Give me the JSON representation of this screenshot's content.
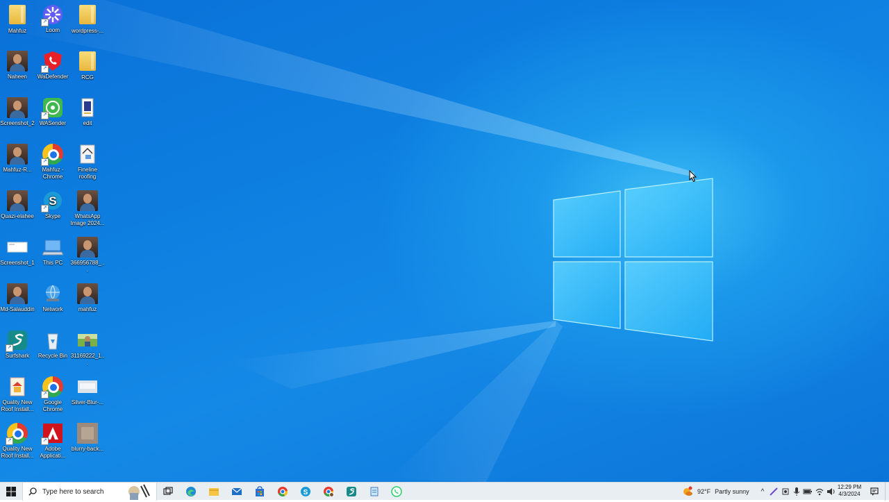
{
  "desktop": {
    "icons": [
      {
        "id": "mahfuz-folder",
        "label": "Mahfuz",
        "kind": "folder-user"
      },
      {
        "id": "loom",
        "label": "Loom",
        "kind": "loom"
      },
      {
        "id": "wordpress-folder",
        "label": "wordpress-...",
        "kind": "zip-folder"
      },
      {
        "id": "naheen",
        "label": "Naheen",
        "kind": "photo"
      },
      {
        "id": "wadefender",
        "label": "WaDefender",
        "kind": "wadefender"
      },
      {
        "id": "rcg-folder",
        "label": "RCG",
        "kind": "zip-folder"
      },
      {
        "id": "screenshot-2",
        "label": "Screenshot_2",
        "kind": "photo"
      },
      {
        "id": "wasender",
        "label": "WASender",
        "kind": "wasender"
      },
      {
        "id": "edit",
        "label": "edit",
        "kind": "document"
      },
      {
        "id": "mahfuz-r",
        "label": "Mahfuz-R...",
        "kind": "photo"
      },
      {
        "id": "mahfuz-chrome",
        "label": "Mahfuz - Chrome",
        "kind": "chrome"
      },
      {
        "id": "fineline-roofing",
        "label": "Fineline roofing",
        "kind": "fineline"
      },
      {
        "id": "quazi-elahee",
        "label": "Quazi-elahee",
        "kind": "photo"
      },
      {
        "id": "skype",
        "label": "Skype",
        "kind": "skype"
      },
      {
        "id": "whatsapp-image",
        "label": "WhatsApp Image 2024...",
        "kind": "photo"
      },
      {
        "id": "screenshot-1",
        "label": "Screenshot_1",
        "kind": "screenshot"
      },
      {
        "id": "this-pc",
        "label": "This PC",
        "kind": "this-pc"
      },
      {
        "id": "file-366956788",
        "label": "366956788_...",
        "kind": "photo"
      },
      {
        "id": "md-salauddin",
        "label": "Md-Salauddin",
        "kind": "photo"
      },
      {
        "id": "network",
        "label": "Network",
        "kind": "network"
      },
      {
        "id": "mahfuz-photo",
        "label": "mahfuz",
        "kind": "photo"
      },
      {
        "id": "surfshark",
        "label": "Surfshark",
        "kind": "surfshark"
      },
      {
        "id": "recycle-bin",
        "label": "Recycle Bin",
        "kind": "recycle-bin"
      },
      {
        "id": "file-31169222",
        "label": "31169222_1...",
        "kind": "landscape"
      },
      {
        "id": "quality-new-roof-1",
        "label": "Quality New Roof Install...",
        "kind": "roof-doc"
      },
      {
        "id": "google-chrome",
        "label": "Google Chrome",
        "kind": "chrome"
      },
      {
        "id": "silver-blur",
        "label": "Silver-Blur-...",
        "kind": "blur-light"
      },
      {
        "id": "quality-new-roof-2",
        "label": "Quality New Roof Install...",
        "kind": "chrome"
      },
      {
        "id": "adobe-app",
        "label": "Adobe Applicati...",
        "kind": "adobe"
      },
      {
        "id": "blurry-back",
        "label": "blurry-back...",
        "kind": "blur-dark"
      }
    ]
  },
  "taskbar": {
    "search_placeholder": "Type here to search",
    "pinned": [
      {
        "id": "task-view",
        "icon": "task-view-icon"
      },
      {
        "id": "edge",
        "icon": "edge-icon"
      },
      {
        "id": "file-explorer",
        "icon": "file-explorer-icon"
      },
      {
        "id": "mail",
        "icon": "mail-icon"
      },
      {
        "id": "store",
        "icon": "store-icon"
      },
      {
        "id": "chrome",
        "icon": "chrome-icon"
      },
      {
        "id": "skype",
        "icon": "skype-icon"
      },
      {
        "id": "chrome-profile",
        "icon": "chrome-profile-icon"
      },
      {
        "id": "surfshark",
        "icon": "surfshark-icon"
      },
      {
        "id": "notepad",
        "icon": "notepad-icon"
      },
      {
        "id": "whatsapp",
        "icon": "whatsapp-icon"
      }
    ],
    "weather": {
      "temperature": "92°F",
      "condition": "Partly sunny"
    },
    "clock": {
      "time": "12:29 PM",
      "date": "4/3/2024"
    }
  }
}
